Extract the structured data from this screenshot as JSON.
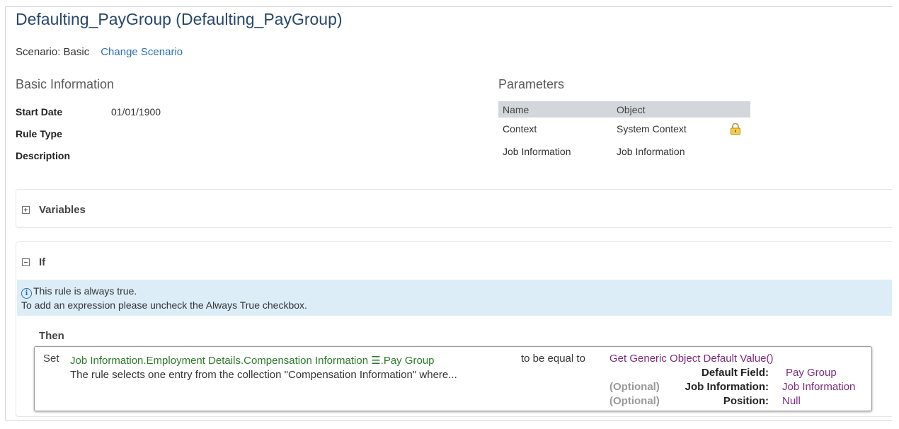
{
  "page": {
    "title": "Defaulting_PayGroup (Defaulting_PayGroup)",
    "scenario_label": "Scenario: Basic",
    "change_scenario": "Change Scenario"
  },
  "basic_info": {
    "heading": "Basic Information",
    "fields": [
      {
        "label": "Start Date",
        "value": "01/01/1900"
      },
      {
        "label": "Rule Type",
        "value": ""
      },
      {
        "label": "Description",
        "value": ""
      }
    ]
  },
  "parameters": {
    "heading": "Parameters",
    "columns": [
      "Name",
      "Object"
    ],
    "rows": [
      {
        "name": "Context",
        "object": "System Context",
        "locked": true
      },
      {
        "name": "Job Information",
        "object": "Job Information",
        "locked": false
      }
    ],
    "lock_icon": "lock-icon"
  },
  "variables": {
    "title": "Variables",
    "icon": "expand-plus-icon",
    "expanded": false
  },
  "if_section": {
    "title": "If",
    "icon": "collapse-minus-icon",
    "expanded": true,
    "info_icon": "info-icon",
    "notice_line1": "This rule is always true.",
    "notice_line2": "To add an expression please uncheck the Always True checkbox."
  },
  "then_section": {
    "title": "Then",
    "set_label": "Set",
    "target_path": "Job Information.Employment Details.Compensation Information ☰.Pay Group",
    "description": "The rule selects one entry from the collection \"Compensation Information\" where...",
    "operator": "to be equal to",
    "function_name": "Get Generic Object Default Value()",
    "args": [
      {
        "optional": "",
        "label": "Default Field:",
        "value": "Pay Group"
      },
      {
        "optional": "(Optional)",
        "label": "Job Information:",
        "value": "Job Information"
      },
      {
        "optional": "(Optional)",
        "label": "Position:",
        "value": "Null"
      }
    ]
  },
  "colors": {
    "title": "#29476b",
    "link": "#2a6fb8",
    "notice_bg": "#dcedf7",
    "path_green": "#2b7a2b",
    "value_purple": "#7c2a7c",
    "table_header_bg": "#d3d7dc"
  }
}
